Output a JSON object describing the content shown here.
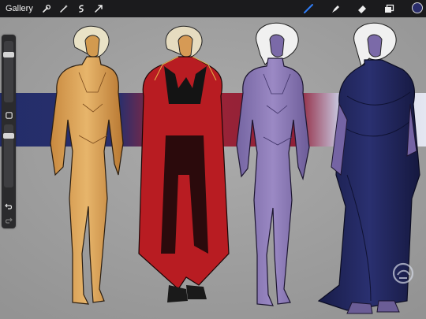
{
  "toolbar": {
    "gallery_label": "Gallery",
    "left_tools": [
      "wrench-icon",
      "magic-wand-icon",
      "selection-icon",
      "transform-icon"
    ],
    "right_tools": [
      "brush-icon",
      "smudge-icon",
      "eraser-icon",
      "layers-icon"
    ],
    "active_tool": "brush-icon",
    "active_color": "#2a2d6b",
    "accent": "#2f7cf6"
  },
  "sidebar": {
    "size_slider_level": 0.2,
    "opacity_slider_level": 0.15,
    "buttons": [
      "square-modify-icon",
      "undo-icon",
      "redo-icon"
    ]
  },
  "canvas": {
    "background": "#a3a3a3",
    "band_colors": [
      "#25306e",
      "#a02535",
      "#8a2038",
      "#d9dcec"
    ],
    "figures": [
      {
        "name": "figure-gold-bodysuit",
        "main_color": "#d9a45a"
      },
      {
        "name": "figure-red-costume",
        "main_color": "#c01f24"
      },
      {
        "name": "figure-lavender-bodysuit",
        "main_color": "#8a78b5"
      },
      {
        "name": "figure-navy-robe",
        "main_color": "#1e2356"
      }
    ]
  }
}
